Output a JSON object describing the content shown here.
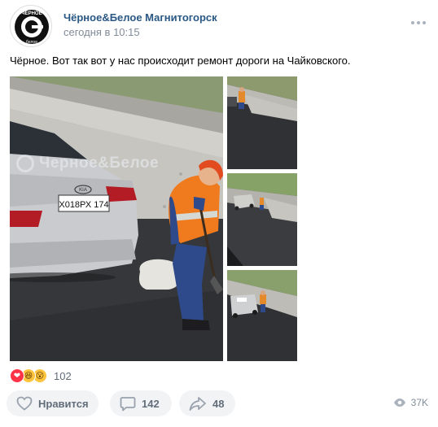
{
  "post": {
    "author": "Чёрное&Белое Магнитогорск",
    "time": "сегодня в 10:15",
    "text": "Чёрное. Вот так вот у нас происходит ремонт дороги на Чайковского.",
    "avatar_text": "ЧЕРНОЕ",
    "avatar_subtext": "белое"
  },
  "photos": {
    "main": {
      "watermark": "Черное&Белое",
      "license_plate": "Х018РХ 174",
      "car_badge": "KIA"
    }
  },
  "reactions": {
    "icons": [
      "heart-icon",
      "laugh-icon",
      "wow-icon"
    ],
    "count": "102"
  },
  "actions": {
    "like_label": "Нравится",
    "comments_count": "142",
    "shares_count": "48",
    "views_count": "37K"
  },
  "colors": {
    "author_link": "#2a5885",
    "secondary_text": "#818c99",
    "button_bg": "#f2f3f5",
    "button_text": "#626d7a",
    "vest_orange": "#f07a1e"
  }
}
